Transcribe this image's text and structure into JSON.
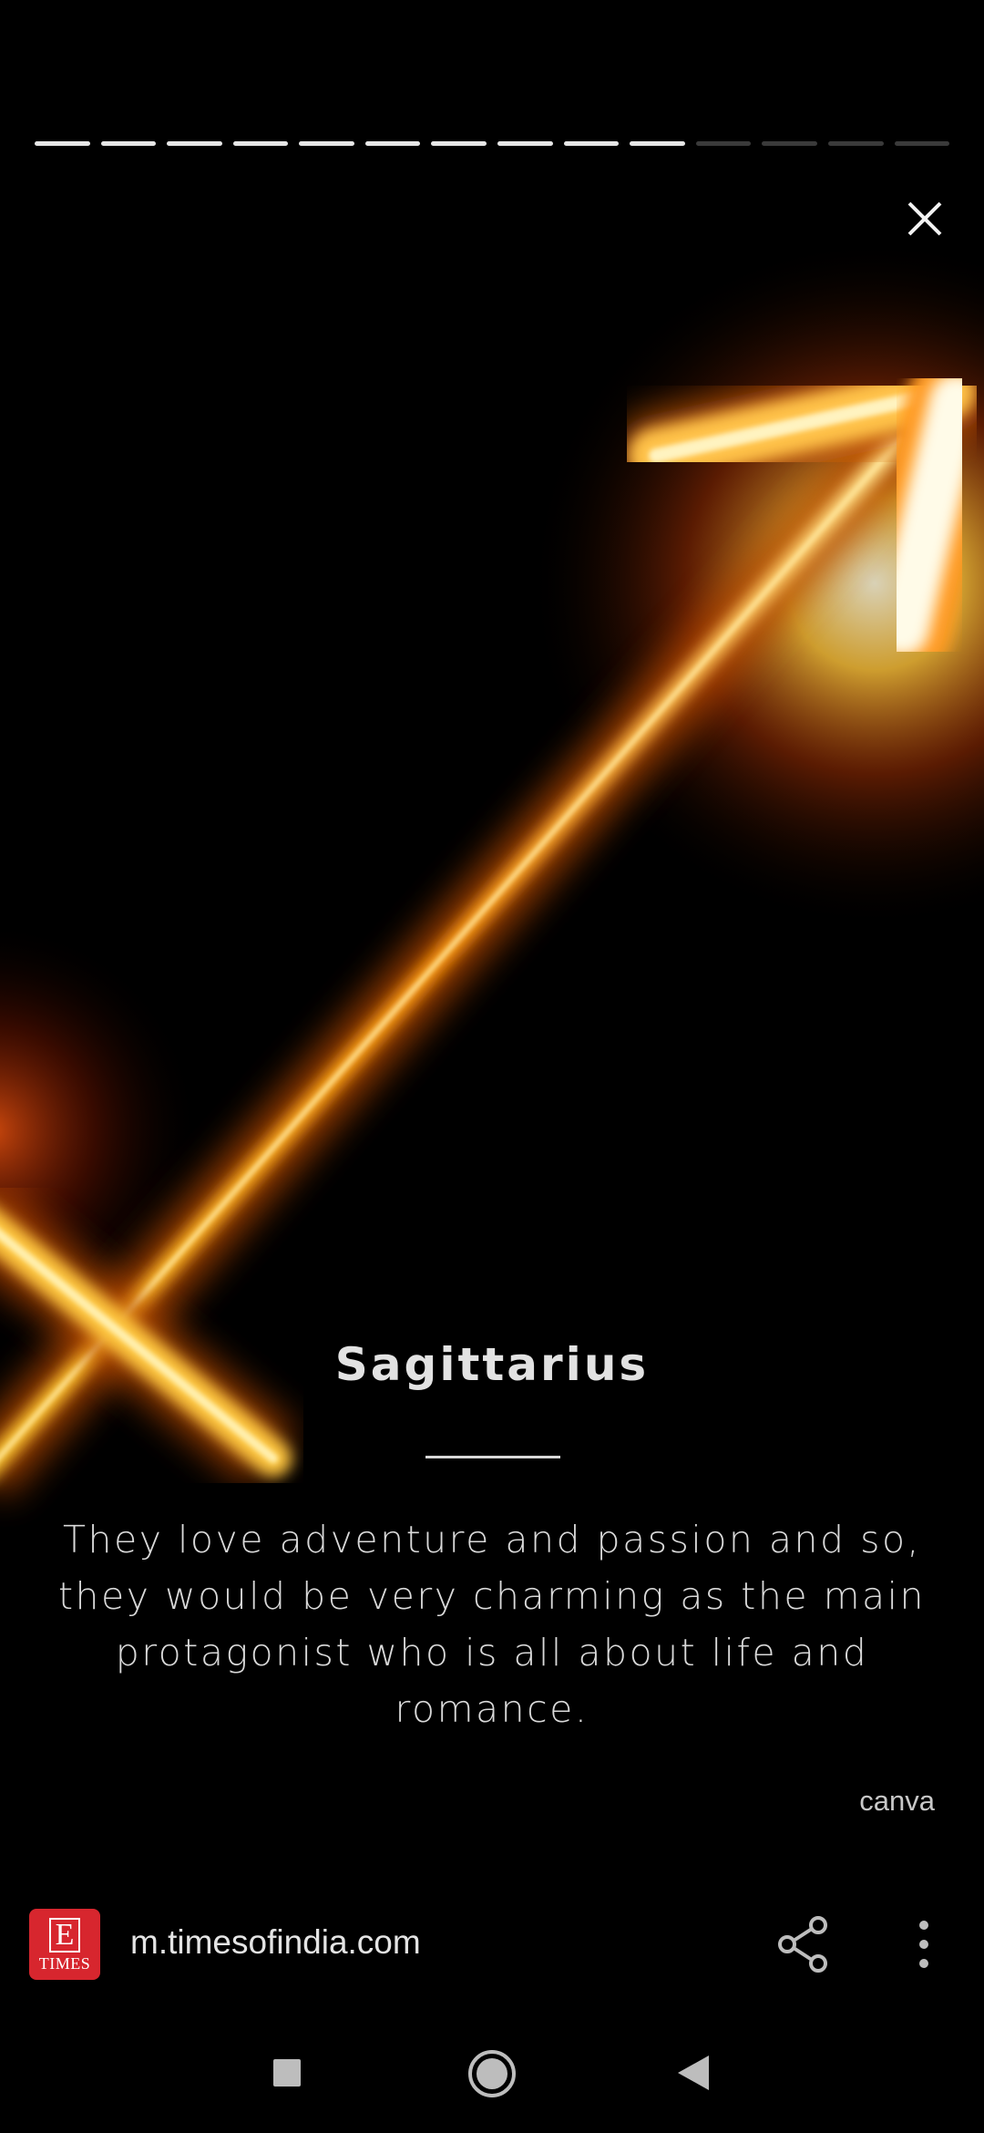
{
  "story": {
    "progress": {
      "total_segments": 14,
      "completed_segments": 10
    },
    "title": "Sagittarius",
    "description": "They love adventure and passion and so, they would be very charming as the main protagonist who is all about life and romance.",
    "credit": "canva",
    "close_icon": "close-icon",
    "background": "glowing-sagittarius-arrow"
  },
  "publisher": {
    "logo_letters": {
      "top": "E",
      "bottom": "TIMES"
    },
    "logo_color": "#d7262e",
    "domain": "m.timesofindia.com",
    "share_icon": "share-icon",
    "more_icon": "more-vertical-icon"
  },
  "navigation": {
    "buttons": [
      "recents-square-icon",
      "home-circle-icon",
      "back-triangle-icon"
    ]
  }
}
